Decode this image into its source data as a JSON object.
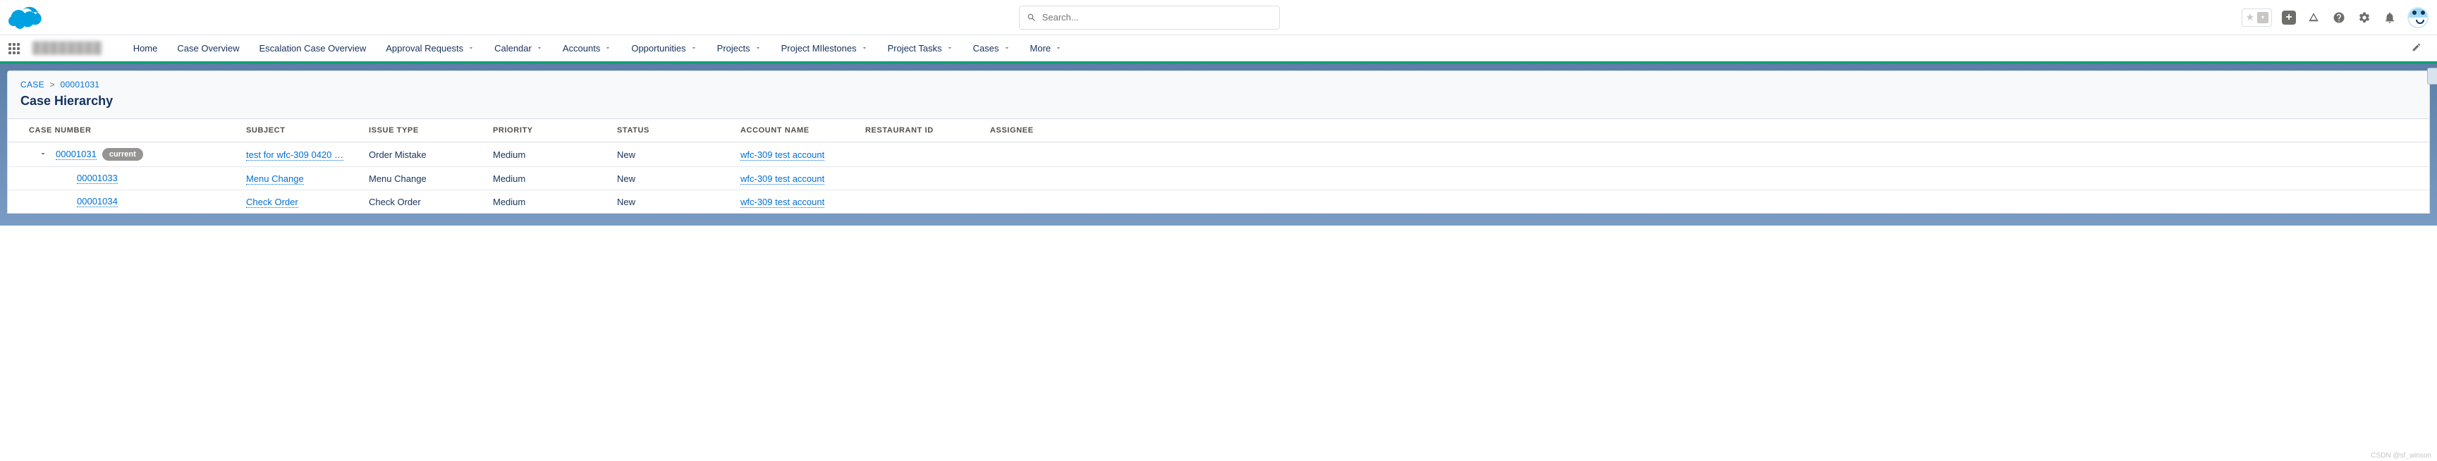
{
  "search": {
    "placeholder": "Search..."
  },
  "nav": {
    "items": [
      {
        "label": "Home",
        "dropdown": false
      },
      {
        "label": "Case Overview",
        "dropdown": false
      },
      {
        "label": "Escalation Case Overview",
        "dropdown": false
      },
      {
        "label": "Approval Requests",
        "dropdown": true
      },
      {
        "label": "Calendar",
        "dropdown": true
      },
      {
        "label": "Accounts",
        "dropdown": true
      },
      {
        "label": "Opportunities",
        "dropdown": true
      },
      {
        "label": "Projects",
        "dropdown": true
      },
      {
        "label": "Project MIlestones",
        "dropdown": true
      },
      {
        "label": "Project Tasks",
        "dropdown": true
      },
      {
        "label": "Cases",
        "dropdown": true
      },
      {
        "label": "More",
        "dropdown": true
      }
    ]
  },
  "breadcrumb": {
    "parent": "CASE",
    "current": "00001031"
  },
  "page_title": "Case Hierarchy",
  "columns": {
    "case_number": "CASE NUMBER",
    "subject": "SUBJECT",
    "issue_type": "ISSUE TYPE",
    "priority": "PRIORITY",
    "status": "STATUS",
    "account_name": "ACCOUNT NAME",
    "restaurant_id": "RESTAURANT ID",
    "assignee": "ASSIGNEE"
  },
  "rows": [
    {
      "level": 0,
      "expandable": true,
      "current": true,
      "case_number": "00001031",
      "subject": "test for wfc-309 0420 …",
      "issue_type": "Order Mistake",
      "priority": "Medium",
      "status": "New",
      "account_name": "wfc-309 test account",
      "restaurant_id": "",
      "assignee": ""
    },
    {
      "level": 1,
      "expandable": false,
      "current": false,
      "case_number": "00001033",
      "subject": "Menu Change",
      "issue_type": "Menu Change",
      "priority": "Medium",
      "status": "New",
      "account_name": "wfc-309 test account",
      "restaurant_id": "",
      "assignee": ""
    },
    {
      "level": 1,
      "expandable": false,
      "current": false,
      "case_number": "00001034",
      "subject": "Check Order",
      "issue_type": "Check Order",
      "priority": "Medium",
      "status": "New",
      "account_name": "wfc-309 test account",
      "restaurant_id": "",
      "assignee": ""
    }
  ],
  "badge_current": "current",
  "watermark": "CSDN @sf_winson"
}
